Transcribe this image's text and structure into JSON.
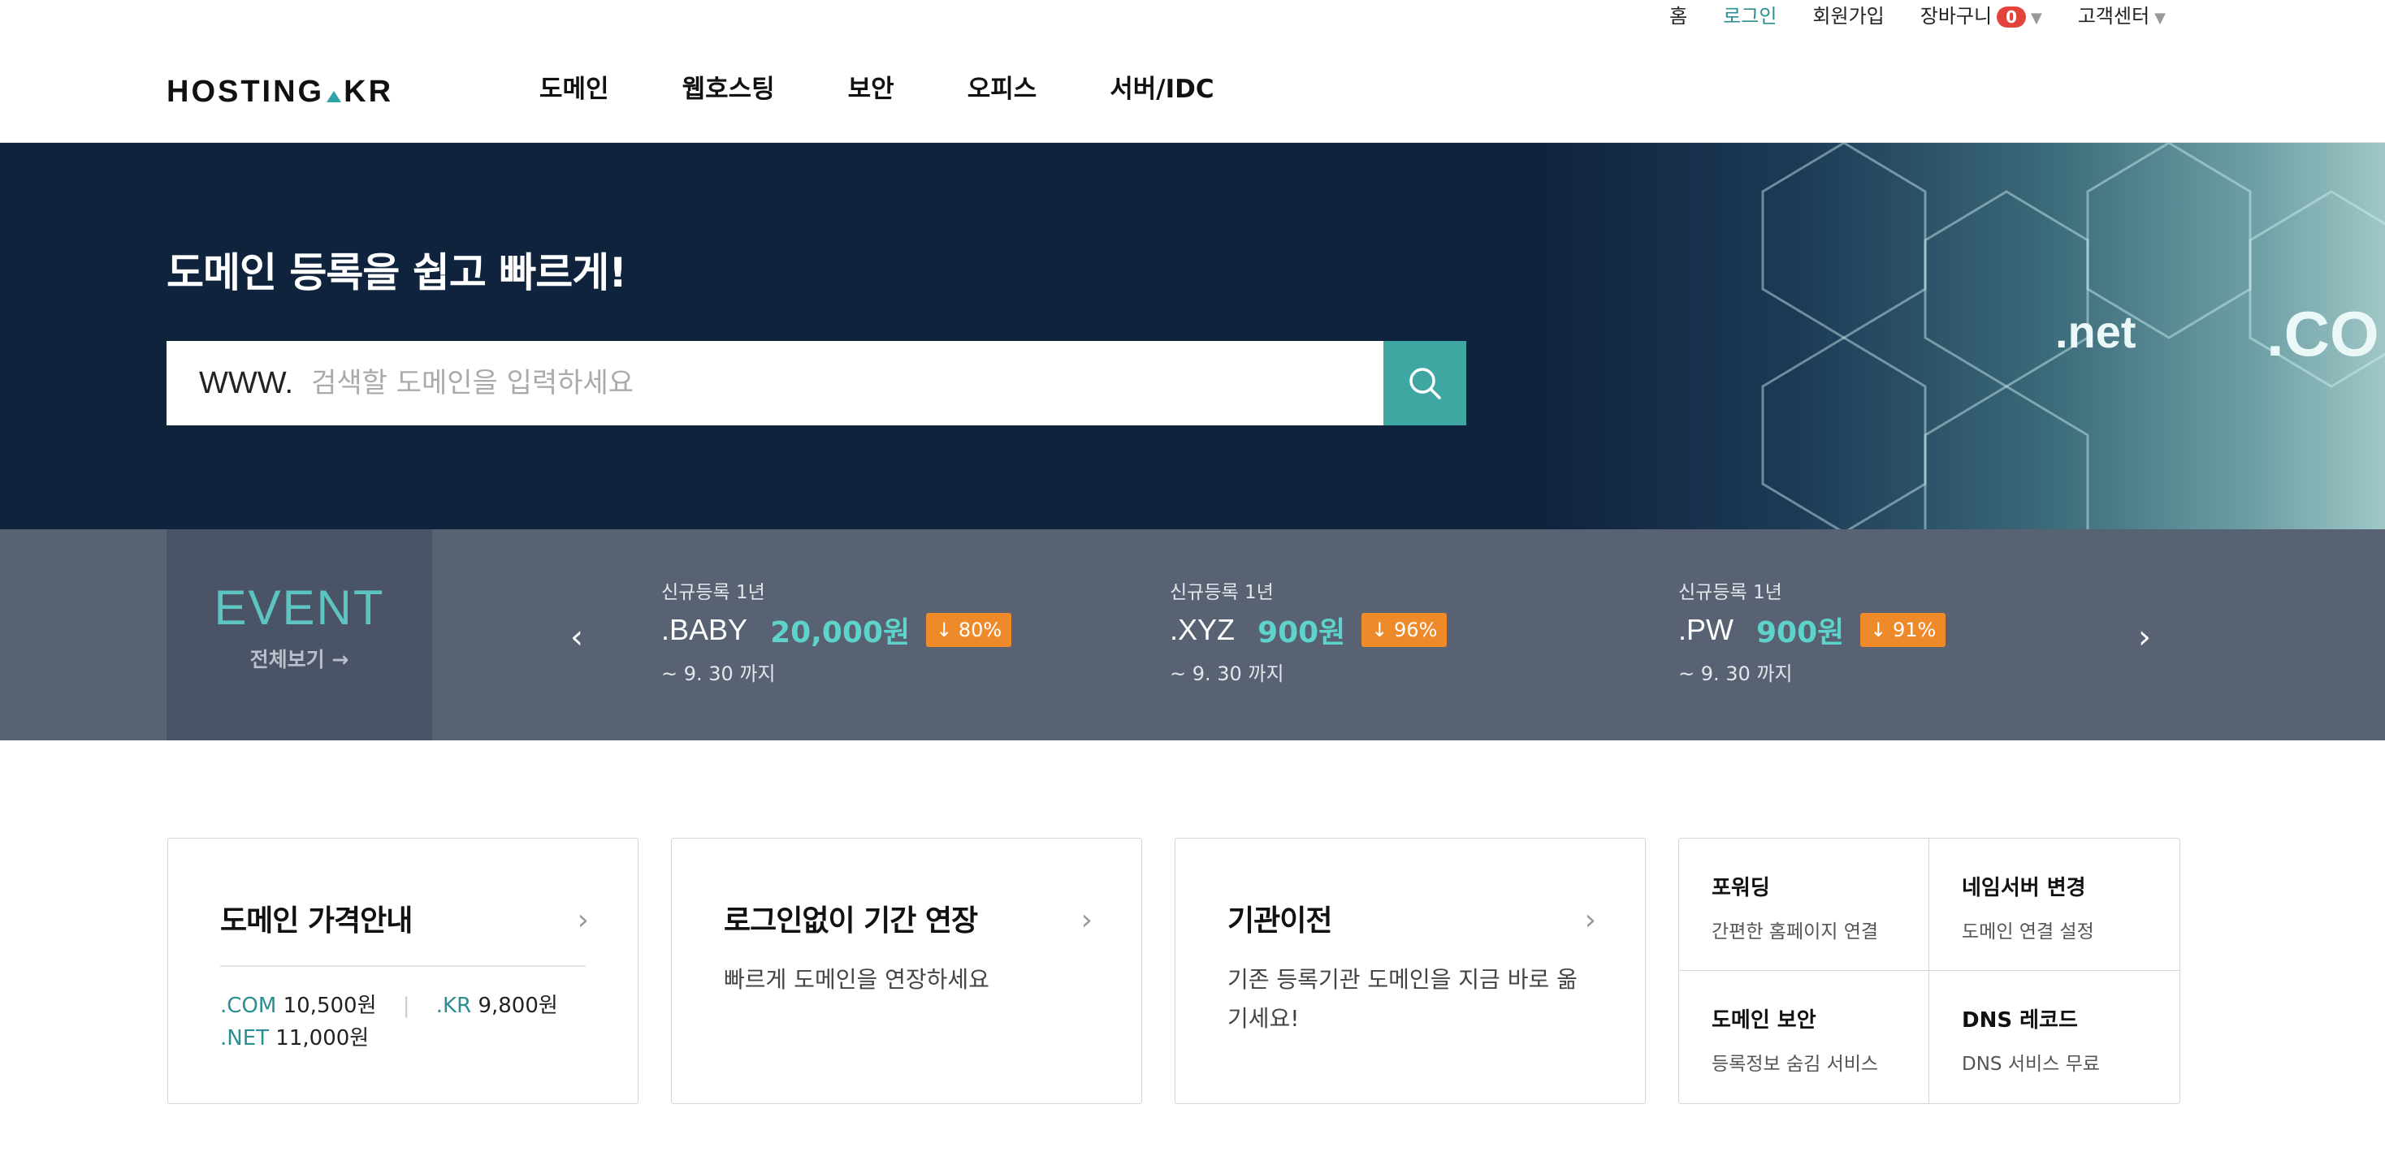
{
  "util": {
    "home": "홈",
    "login": "로그인",
    "signup": "회원가입",
    "cart": "장바구니",
    "cart_count": "0",
    "support": "고객센터"
  },
  "logo": {
    "left": "HOSTING",
    "right": "KR"
  },
  "nav": [
    "도메인",
    "웹호스팅",
    "보안",
    "오피스",
    "서버/IDC"
  ],
  "hero": {
    "title": "도메인 등록을 쉽고 빠르게!",
    "prefix": "WWW.",
    "placeholder": "검색할 도메인을 입력하세요",
    "bg_net": ".net",
    "bg_com": ".CO"
  },
  "event": {
    "title": "EVENT",
    "view_all": "전체보기 →",
    "promos": [
      {
        "caption": "신규등록 1년",
        "tld": ".BABY",
        "price": "20,000원",
        "discount": "↓ 80%",
        "until": "~ 9. 30 까지"
      },
      {
        "caption": "신규등록 1년",
        "tld": ".XYZ",
        "price": "900원",
        "discount": "↓ 96%",
        "until": "~ 9. 30 까지"
      },
      {
        "caption": "신규등록 1년",
        "tld": ".PW",
        "price": "900원",
        "discount": "↓ 91%",
        "until": "~ 9. 30 까지"
      }
    ]
  },
  "cards": {
    "price": {
      "title": "도메인 가격안내",
      "items": [
        {
          "tld": ".COM",
          "price": "10,500원"
        },
        {
          "tld": ".KR",
          "price": "9,800원"
        },
        {
          "tld": ".NET",
          "price": "11,000원"
        }
      ]
    },
    "renew": {
      "title": "로그인없이 기간 연장",
      "desc": "빠르게 도메인을 연장하세요"
    },
    "transfer": {
      "title": "기관이전",
      "desc": "기존 등록기관 도메인을 지금 바로 옮기세요!"
    },
    "grid": [
      {
        "title": "포워딩",
        "sub": "간편한 홈페이지 연결"
      },
      {
        "title": "네임서버 변경",
        "sub": "도메인 연결 설정"
      },
      {
        "title": "도메인 보안",
        "sub": "등록정보 숨김 서비스"
      },
      {
        "title": "DNS 레코드",
        "sub": "DNS 서비스 무료"
      }
    ]
  },
  "colors": {
    "teal": "#3fa7a2",
    "navy": "#0f233d",
    "orange": "#ee8a2a",
    "badge_red": "#e2443b"
  }
}
